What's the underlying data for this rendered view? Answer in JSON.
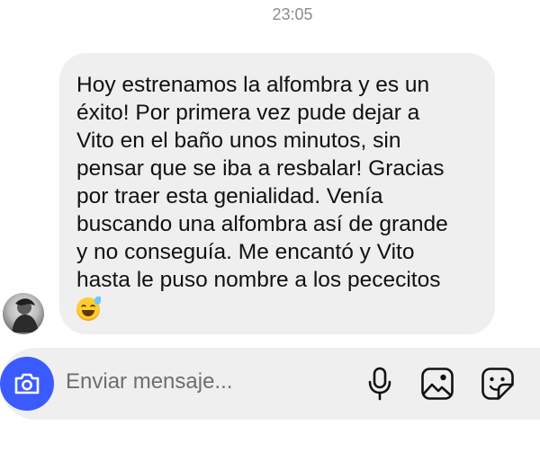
{
  "chat": {
    "timestamp": "23:05",
    "message": {
      "text": "Hoy estrenamos la alfombra y  es un\néxito! Por primera vez pude dejar a\nVito en el baño unos minutos, sin\npensar que se iba a resbalar! Gracias\npor traer esta genialidad. Venía\nbuscando una alfombra así de grande\ny no conseguía. Me encantó y Vito\nhasta le puso nombre a los pececitos",
      "emoji": "grinning-face-with-sweat"
    }
  },
  "composer": {
    "placeholder": "Enviar mensaje...",
    "camera_icon": "camera-icon",
    "mic_icon": "microphone-icon",
    "gallery_icon": "image-icon",
    "sticker_icon": "sticker-icon"
  },
  "colors": {
    "accent": "#3b5bff",
    "bubble": "#efefef",
    "composer_bg": "#efefef",
    "text": "#111111",
    "muted": "#8a8d91"
  }
}
